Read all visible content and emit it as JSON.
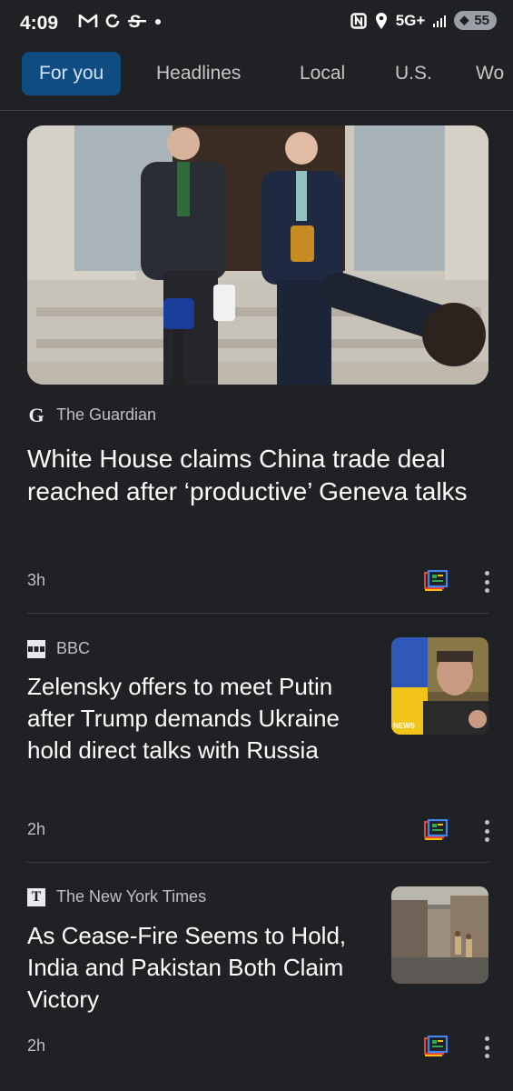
{
  "status": {
    "time": "4:09",
    "network": "5G+",
    "battery": "55",
    "left_icons": [
      "gmail-icon",
      "sync-icon",
      "app-s-icon",
      "dot-icon"
    ],
    "right_icons": [
      "nfc-icon",
      "location-icon",
      "signal-icon",
      "battery-icon"
    ]
  },
  "tabs": [
    {
      "label": "For you",
      "active": true
    },
    {
      "label": "Headlines",
      "active": false
    },
    {
      "label": "Local",
      "active": false
    },
    {
      "label": "U.S.",
      "active": false
    },
    {
      "label": "Wo",
      "active": false
    }
  ],
  "articles": [
    {
      "source": "The Guardian",
      "source_logo": "G",
      "headline": "White House claims China trade deal reached after ‘productive’ Geneva talks",
      "age": "3h",
      "image": "trade-officials-press-photo"
    },
    {
      "source": "BBC",
      "source_logo": "BBC",
      "headline": "Zelensky offers to meet Putin after Trump demands Ukraine hold direct talks with Russia",
      "age": "2h",
      "thumb_caption": "NEWS",
      "image": "zelensky-thumbnail"
    },
    {
      "source": "The New York Times",
      "source_logo": "T",
      "headline": "As Cease-Fire Seems to Hold, India and Pakistan Both Claim Victory",
      "age": "2h",
      "image": "street-police-thumbnail"
    }
  ],
  "colors": {
    "background": "#202124",
    "active_tab_bg": "#0f4c81",
    "active_tab_text": "#d3e3fd",
    "divider": "#3c4043"
  }
}
